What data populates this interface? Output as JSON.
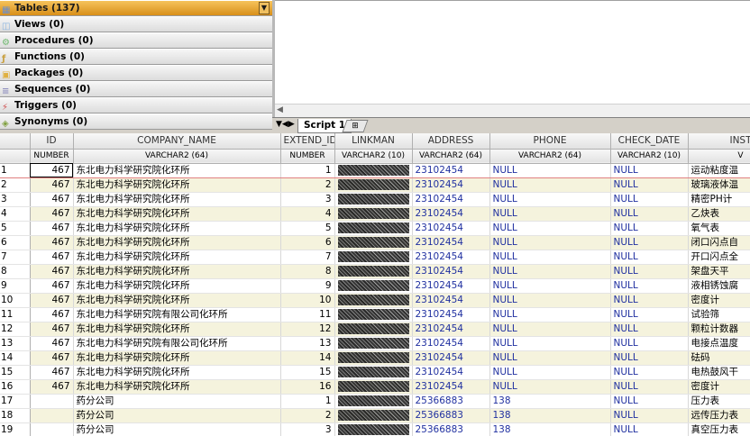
{
  "navigator": {
    "items": [
      {
        "label": "Tables (137)",
        "icon": "table-icon",
        "active": true
      },
      {
        "label": "Views (0)",
        "icon": "view-icon"
      },
      {
        "label": "Procedures (0)",
        "icon": "procedure-icon"
      },
      {
        "label": "Functions (0)",
        "icon": "function-icon"
      },
      {
        "label": "Packages (0)",
        "icon": "package-icon"
      },
      {
        "label": "Sequences (0)",
        "icon": "sequence-icon"
      },
      {
        "label": "Triggers (0)",
        "icon": "trigger-icon"
      },
      {
        "label": "Synonyms (0)",
        "icon": "synonym-icon"
      }
    ]
  },
  "tabs": {
    "script_label": "Script 1"
  },
  "grid": {
    "columns": [
      "ID",
      "COMPANY_NAME",
      "EXTEND_ID",
      "LINKMAN",
      "ADDRESS",
      "PHONE",
      "CHECK_DATE",
      "INST"
    ],
    "types": [
      "NUMBER",
      "VARCHAR2 (64)",
      "NUMBER",
      "VARCHAR2 (10)",
      "VARCHAR2 (64)",
      "VARCHAR2 (64)",
      "VARCHAR2 (10)",
      "V"
    ],
    "rows": [
      {
        "n": "1",
        "id": "467",
        "company": "东北电力科学研究院化环所",
        "ext": "1",
        "address": "23102454",
        "phone": "NULL",
        "check": "NULL",
        "inst": "运动粘度温"
      },
      {
        "n": "2",
        "id": "467",
        "company": "东北电力科学研究院化环所",
        "ext": "2",
        "address": "23102454",
        "phone": "NULL",
        "check": "NULL",
        "inst": "玻璃液体温"
      },
      {
        "n": "3",
        "id": "467",
        "company": "东北电力科学研究院化环所",
        "ext": "3",
        "address": "23102454",
        "phone": "NULL",
        "check": "NULL",
        "inst": "精密PH计"
      },
      {
        "n": "4",
        "id": "467",
        "company": "东北电力科学研究院化环所",
        "ext": "4",
        "address": "23102454",
        "phone": "NULL",
        "check": "NULL",
        "inst": "乙炔表"
      },
      {
        "n": "5",
        "id": "467",
        "company": "东北电力科学研究院化环所",
        "ext": "5",
        "address": "23102454",
        "phone": "NULL",
        "check": "NULL",
        "inst": "氧气表"
      },
      {
        "n": "6",
        "id": "467",
        "company": "东北电力科学研究院化环所",
        "ext": "6",
        "address": "23102454",
        "phone": "NULL",
        "check": "NULL",
        "inst": "闭口闪点自"
      },
      {
        "n": "7",
        "id": "467",
        "company": "东北电力科学研究院化环所",
        "ext": "7",
        "address": "23102454",
        "phone": "NULL",
        "check": "NULL",
        "inst": "开口闪点全"
      },
      {
        "n": "8",
        "id": "467",
        "company": "东北电力科学研究院化环所",
        "ext": "8",
        "address": "23102454",
        "phone": "NULL",
        "check": "NULL",
        "inst": "架盘天平"
      },
      {
        "n": "9",
        "id": "467",
        "company": "东北电力科学研究院化环所",
        "ext": "9",
        "address": "23102454",
        "phone": "NULL",
        "check": "NULL",
        "inst": "液相锈蚀腐"
      },
      {
        "n": "10",
        "id": "467",
        "company": "东北电力科学研究院化环所",
        "ext": "10",
        "address": "23102454",
        "phone": "NULL",
        "check": "NULL",
        "inst": "密度计"
      },
      {
        "n": "11",
        "id": "467",
        "company": "东北电力科学研究院有限公司化环所",
        "ext": "11",
        "address": "23102454",
        "phone": "NULL",
        "check": "NULL",
        "inst": "试验筛"
      },
      {
        "n": "12",
        "id": "467",
        "company": "东北电力科学研究院化环所",
        "ext": "12",
        "address": "23102454",
        "phone": "NULL",
        "check": "NULL",
        "inst": "颗粒计数器"
      },
      {
        "n": "13",
        "id": "467",
        "company": "东北电力科学研究院有限公司化环所",
        "ext": "13",
        "address": "23102454",
        "phone": "NULL",
        "check": "NULL",
        "inst": "电接点温度"
      },
      {
        "n": "14",
        "id": "467",
        "company": "东北电力科学研究院化环所",
        "ext": "14",
        "address": "23102454",
        "phone": "NULL",
        "check": "NULL",
        "inst": "砝码"
      },
      {
        "n": "15",
        "id": "467",
        "company": "东北电力科学研究院化环所",
        "ext": "15",
        "address": "23102454",
        "phone": "NULL",
        "check": "NULL",
        "inst": "电热鼓风干"
      },
      {
        "n": "16",
        "id": "467",
        "company": "东北电力科学研究院化环所",
        "ext": "16",
        "address": "23102454",
        "phone": "NULL",
        "check": "NULL",
        "inst": "密度计"
      },
      {
        "n": "17",
        "id": "",
        "company": "药分公司",
        "ext": "1",
        "address": "25366883",
        "phone": "138",
        "check": "NULL",
        "inst": "压力表"
      },
      {
        "n": "18",
        "id": "",
        "company": "药分公司",
        "ext": "2",
        "address": "25366883",
        "phone": "138",
        "check": "NULL",
        "inst": "远传压力表"
      },
      {
        "n": "19",
        "id": "",
        "company": "药分公司",
        "ext": "3",
        "address": "25366883",
        "phone": "138",
        "check": "NULL",
        "inst": "真空压力表"
      }
    ]
  }
}
